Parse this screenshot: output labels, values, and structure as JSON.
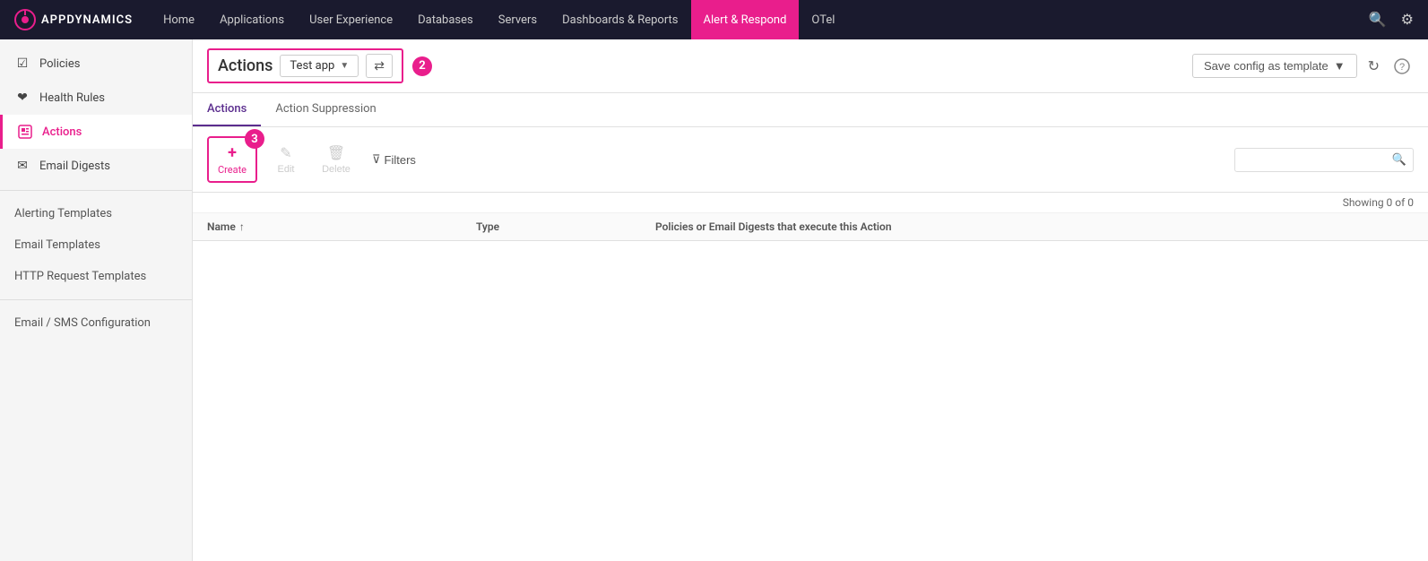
{
  "topnav": {
    "logo_text": "APPDYNAMICS",
    "items": [
      {
        "id": "home",
        "label": "Home",
        "active": false
      },
      {
        "id": "applications",
        "label": "Applications",
        "active": false
      },
      {
        "id": "user-experience",
        "label": "User Experience",
        "active": false
      },
      {
        "id": "databases",
        "label": "Databases",
        "active": false
      },
      {
        "id": "servers",
        "label": "Servers",
        "active": false
      },
      {
        "id": "dashboards-reports",
        "label": "Dashboards & Reports",
        "active": false
      },
      {
        "id": "alert-respond",
        "label": "Alert & Respond",
        "active": true
      },
      {
        "id": "otel",
        "label": "OTel",
        "active": false
      }
    ]
  },
  "sidebar": {
    "items": [
      {
        "id": "policies",
        "label": "Policies",
        "icon": "☑",
        "active": false
      },
      {
        "id": "health-rules",
        "label": "Health Rules",
        "icon": "❤",
        "active": false
      },
      {
        "id": "actions",
        "label": "Actions",
        "icon": "▣",
        "active": true
      },
      {
        "id": "email-digests",
        "label": "Email Digests",
        "icon": "✉",
        "active": false
      }
    ],
    "plain_items": [
      {
        "id": "alerting-templates",
        "label": "Alerting Templates"
      },
      {
        "id": "email-templates",
        "label": "Email Templates"
      },
      {
        "id": "http-request-templates",
        "label": "HTTP Request Templates"
      },
      {
        "id": "email-sms-configuration",
        "label": "Email / SMS Configuration"
      }
    ]
  },
  "header": {
    "title": "Actions",
    "app_selector_label": "Test app",
    "annotation_2": "2",
    "save_config_label": "Save config as template",
    "refresh_icon": "↻",
    "help_icon": "?"
  },
  "tabs": [
    {
      "id": "actions",
      "label": "Actions",
      "active": true
    },
    {
      "id": "action-suppression",
      "label": "Action Suppression",
      "active": false
    }
  ],
  "toolbar": {
    "create_label": "Create",
    "edit_label": "Edit",
    "delete_label": "Delete",
    "filters_label": "Filters",
    "annotation_3": "3",
    "search_placeholder": ""
  },
  "table": {
    "columns": [
      {
        "id": "name",
        "label": "Name",
        "sort_indicator": "↑"
      },
      {
        "id": "type",
        "label": "Type"
      },
      {
        "id": "policies",
        "label": "Policies or Email Digests that execute this Action"
      }
    ],
    "showing_text": "Showing 0 of 0",
    "rows": []
  },
  "colors": {
    "accent": "#e91e8c",
    "nav_bg": "#1a1a2e",
    "active_tab": "#5b2d8e"
  }
}
